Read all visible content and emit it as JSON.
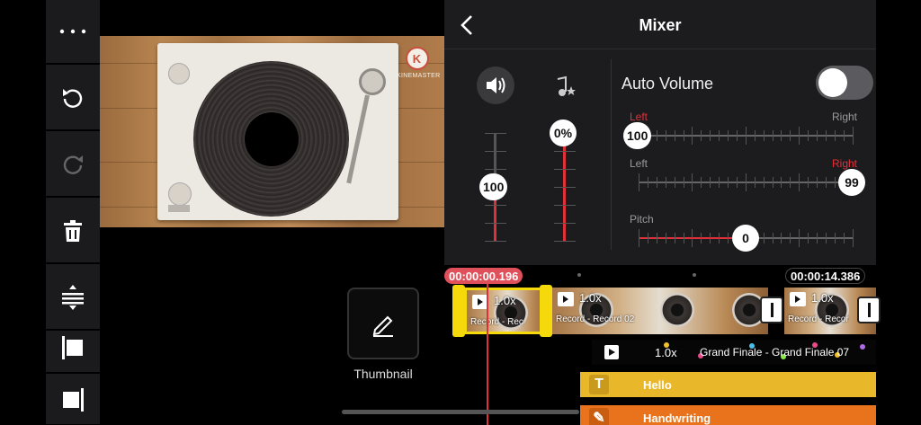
{
  "toolbar": {
    "items": [
      "more",
      "undo",
      "redo",
      "delete",
      "split",
      "trim-left",
      "trim-right"
    ]
  },
  "preview": {
    "logo_letter": "K",
    "logo_text": "KINEMASTER"
  },
  "mixer": {
    "title": "Mixer",
    "clip_volume": "100",
    "clip_volume_level": 0.5,
    "effect_volume": "0%",
    "effect_volume_level": 1.0,
    "auto_volume_label": "Auto Volume",
    "auto_volume_on": false,
    "pan_left": {
      "left_label": "Left",
      "right_label": "Right",
      "value": "100"
    },
    "pan_right": {
      "left_label": "Left",
      "right_label": "Right",
      "value": "99"
    },
    "pitch": {
      "label": "Pitch",
      "value": "0"
    },
    "colors": {
      "accent": "#e0303a",
      "panel": "#1c1c1e"
    }
  },
  "thumbnail": {
    "label": "Thumbnail"
  },
  "timeline": {
    "current_time": "00:00:00.196",
    "total_time": "00:00:14.386",
    "clips": [
      {
        "speed": "1.0x",
        "name": "Record - Rec"
      },
      {
        "speed": "1.0x",
        "name": "Record - Record 02"
      },
      {
        "speed": "1.0x",
        "name": "Record - Recor"
      }
    ],
    "audio": {
      "speed": "1.0x",
      "name": "Grand Finale - Grand Finale 07"
    },
    "layers": [
      {
        "icon": "T",
        "label": "Hello",
        "color": "#e8b72a"
      },
      {
        "icon": "✎",
        "label": "Handwriting",
        "color": "#e8731c"
      }
    ]
  }
}
